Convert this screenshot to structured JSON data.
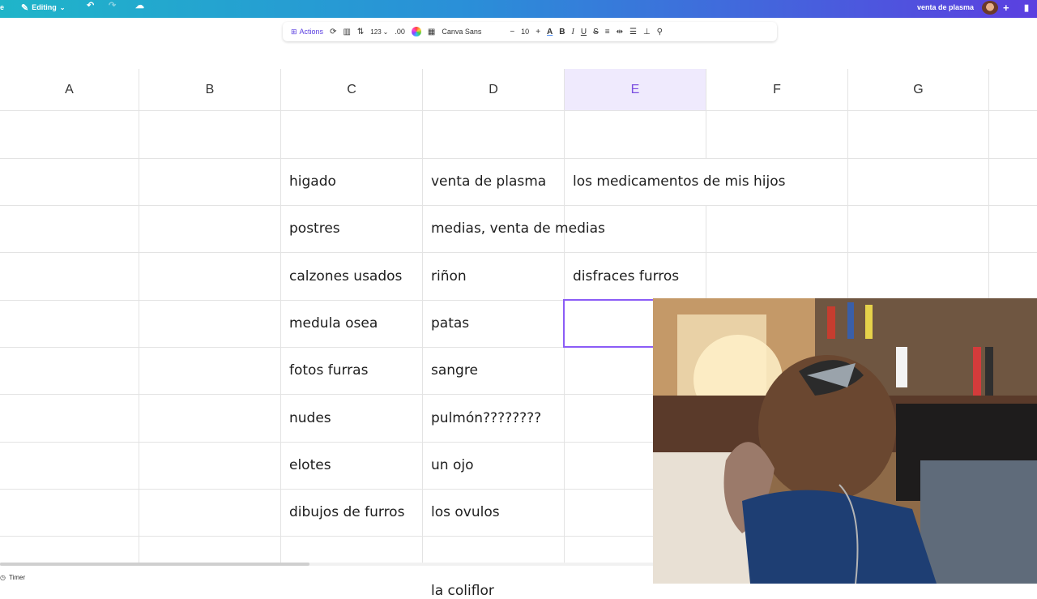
{
  "topbar": {
    "left_partial": "e",
    "editing_label": "Editing",
    "doc_title": "venta de plasma"
  },
  "toolbar": {
    "actions_label": "Actions",
    "number_format": "123",
    "decimals": ".00",
    "font_family": "Canva Sans",
    "font_size": "10",
    "minus": "−",
    "plus": "+",
    "bold": "B",
    "italic": "I",
    "underline": "U",
    "strike": "S"
  },
  "sheet": {
    "columns": [
      "A",
      "B",
      "C",
      "D",
      "E",
      "F",
      "G"
    ],
    "selected_column": "E",
    "cells": {
      "C2": "higado",
      "D2": "venta de plasma",
      "E2": "los medicamentos de mis hijos",
      "C3": "postres",
      "D3": "medias, venta de medias",
      "C4": "calzones usados",
      "D4": "riñon",
      "E4": "disfraces furros",
      "C5": "medula osea",
      "D5": "patas",
      "C6": "fotos furras",
      "D6": "sangre",
      "C7": "nudes",
      "D7": "pulmón????????",
      "C8": "elotes",
      "D8": "un ojo",
      "C9": "dibujos de furros",
      "D9": "los ovulos",
      "D10": "la coliflor"
    }
  },
  "bottombar": {
    "timer_label": "Timer"
  },
  "colors": {
    "accent": "#8b5cf6",
    "selected_header_bg": "#efeafd"
  }
}
